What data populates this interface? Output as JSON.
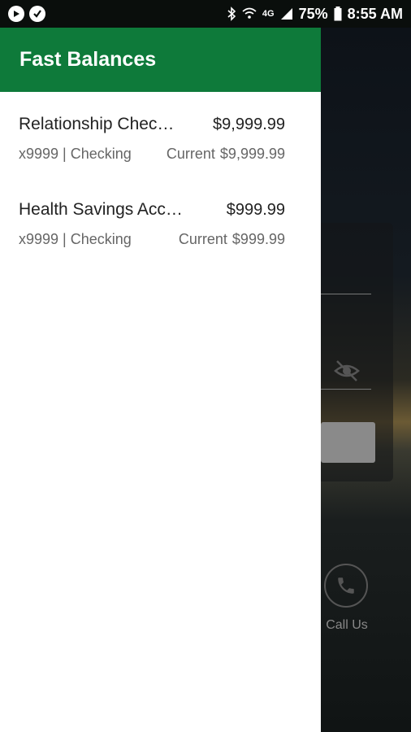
{
  "status_bar": {
    "battery": "75%",
    "time": "8:55 AM",
    "network": "4G"
  },
  "drawer": {
    "title": "Fast Balances",
    "accounts": [
      {
        "name": "Relationship Chec…",
        "balance": "$9,999.99",
        "number_type": "x9999 | Checking",
        "current_label": "Current",
        "current_amount": "$9,999.99"
      },
      {
        "name": "Health Savings Acc…",
        "balance": "$999.99",
        "number_type": "x9999 | Checking",
        "current_label": "Current",
        "current_amount": "$999.99"
      }
    ]
  },
  "background": {
    "call_label": "Call Us"
  },
  "colors": {
    "header_green": "#0e7a3a"
  }
}
